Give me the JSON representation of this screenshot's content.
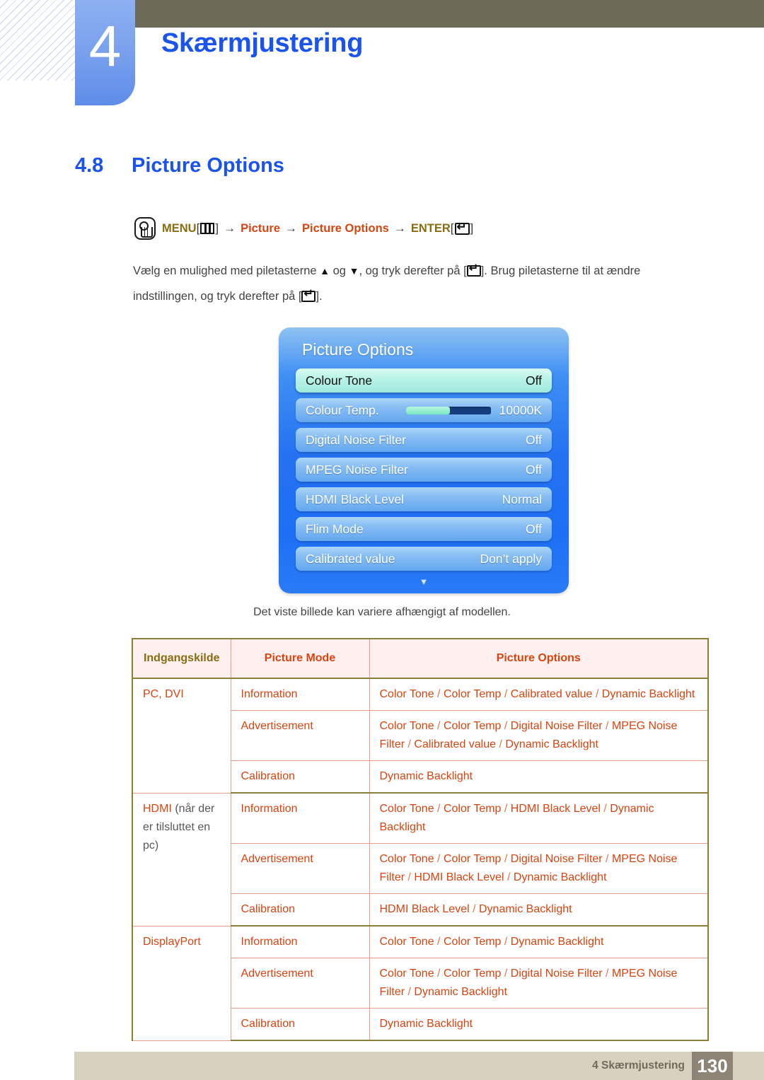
{
  "header": {
    "chapter_number": "4",
    "chapter_title": "Skærmjustering"
  },
  "section": {
    "number": "4.8",
    "title": "Picture Options"
  },
  "menu_path": {
    "hand_icon": "hand-press-icon",
    "menu_label": "MENU",
    "menu_glyph": "menu-bars-icon",
    "arrow1": "→",
    "item1": "Picture",
    "arrow2": "→",
    "item2": "Picture Options",
    "arrow3": "→",
    "enter_label": "ENTER",
    "enter_glyph": "enter-return-icon",
    "bracket_open": "[",
    "bracket_close": "]"
  },
  "instructions": {
    "part1": "Vælg en mulighed med piletasterne",
    "up_arrow": "▲",
    "and": "og",
    "down_arrow": "▼",
    "part2": ", og tryk derefter på [",
    "part3": "]. Brug piletasterne til at ændre",
    "part4": "indstillingen, og tryk derefter på [",
    "part5": "]."
  },
  "osd": {
    "title": "Picture Options",
    "scroll_down_arrow": "▼",
    "rows": [
      {
        "label": "Colour Tone",
        "value": "Off",
        "selected": true,
        "slider": null
      },
      {
        "label": "Colour Temp.",
        "value": "10000K",
        "selected": false,
        "slider": 52
      },
      {
        "label": "Digital Noise Filter",
        "value": "Off",
        "selected": false,
        "slider": null
      },
      {
        "label": "MPEG Noise Filter",
        "value": "Off",
        "selected": false,
        "slider": null
      },
      {
        "label": "HDMI Black Level",
        "value": "Normal",
        "selected": false,
        "slider": null
      },
      {
        "label": "Flim Mode",
        "value": "Off",
        "selected": false,
        "slider": null
      },
      {
        "label": "Calibrated value",
        "value": "Don’t apply",
        "selected": false,
        "slider": null
      }
    ]
  },
  "caption": "Det viste billede kan variere afhængigt af modellen.",
  "table": {
    "headers": [
      "Indgangskilde",
      "Picture Mode",
      "Picture Options"
    ],
    "rows": [
      {
        "source": "PC, DVI",
        "source_note": "",
        "mode": "Information",
        "options": "Color Tone / Color Temp / Calibrated value / Dynamic Backlight",
        "first_of_group": true,
        "group_end": false
      },
      {
        "source": "",
        "source_note": "",
        "mode": "Advertisement",
        "options": "Color Tone / Color Temp / Digital Noise Filter / MPEG Noise Filter / Calibrated value / Dynamic Backlight",
        "first_of_group": false,
        "group_end": false
      },
      {
        "source": "",
        "source_note": "",
        "mode": "Calibration",
        "options": "Dynamic Backlight",
        "first_of_group": false,
        "group_end": true
      },
      {
        "source": "HDMI",
        "source_note": " (når der er tilsluttet en pc)",
        "mode": "Information",
        "options": "Color Tone / Color Temp / HDMI Black Level / Dynamic Backlight",
        "first_of_group": true,
        "group_end": false
      },
      {
        "source": "",
        "source_note": "",
        "mode": "Advertisement",
        "options": "Color Tone / Color Temp / Digital Noise Filter / MPEG Noise Filter / HDMI Black Level / Dynamic Backlight",
        "first_of_group": false,
        "group_end": false
      },
      {
        "source": "",
        "source_note": "",
        "mode": "Calibration",
        "options": "HDMI Black Level / Dynamic Backlight",
        "first_of_group": false,
        "group_end": true
      },
      {
        "source": "DisplayPort",
        "source_note": "",
        "mode": "Information",
        "options": "Color Tone / Color Temp / Dynamic Backlight",
        "first_of_group": true,
        "group_end": false
      },
      {
        "source": "",
        "source_note": "",
        "mode": "Advertisement",
        "options": "Color Tone / Color Temp / Digital Noise Filter / MPEG Noise Filter / Dynamic Backlight",
        "first_of_group": false,
        "group_end": false
      },
      {
        "source": "",
        "source_note": "",
        "mode": "Calibration",
        "options": "Dynamic Backlight",
        "first_of_group": false,
        "group_end": true
      }
    ]
  },
  "footer": {
    "text": "4 Skærmjustering",
    "page_number": "130"
  },
  "colors": {
    "heading_blue": "#1a53ee",
    "olive": "#6d6b56",
    "table_red": "#d94411",
    "table_gold": "#8a6d11",
    "footer_bar": "#d7d2bf",
    "footer_page_box": "#8e8475"
  }
}
